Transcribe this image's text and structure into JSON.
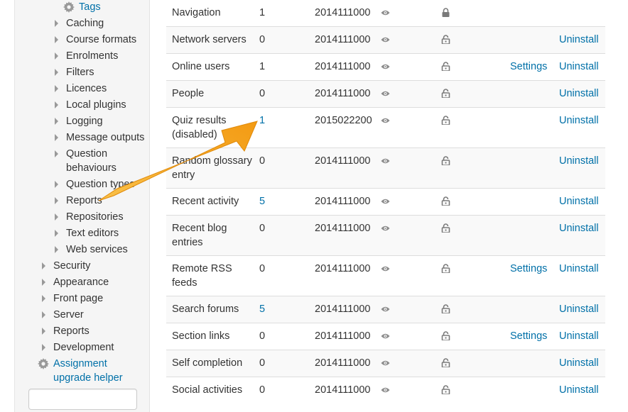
{
  "sidebar": {
    "tags_label": "Tags",
    "sub_items": [
      {
        "label": "Caching"
      },
      {
        "label": "Course formats"
      },
      {
        "label": "Enrolments"
      },
      {
        "label": "Filters"
      },
      {
        "label": "Licences"
      },
      {
        "label": "Local plugins"
      },
      {
        "label": "Logging"
      },
      {
        "label": "Message outputs"
      },
      {
        "label": "Question behaviours"
      },
      {
        "label": "Question types"
      },
      {
        "label": "Reports"
      },
      {
        "label": "Repositories"
      },
      {
        "label": "Text editors"
      },
      {
        "label": "Web services"
      }
    ],
    "top_items": [
      {
        "label": "Security"
      },
      {
        "label": "Appearance"
      },
      {
        "label": "Front page"
      },
      {
        "label": "Server"
      },
      {
        "label": "Reports"
      },
      {
        "label": "Development"
      }
    ],
    "assignment_helper_label": "Assignment upgrade helper",
    "search_value": ""
  },
  "plugins": [
    {
      "name": "Navigation",
      "count": "1",
      "version": "2014111000",
      "settings": "",
      "uninstall": ""
    },
    {
      "name": "Network servers",
      "count": "0",
      "version": "2014111000",
      "settings": "",
      "uninstall": "Uninstall"
    },
    {
      "name": "Online users",
      "count": "1",
      "version": "2014111000",
      "settings": "Settings",
      "uninstall": "Uninstall"
    },
    {
      "name": "People",
      "count": "0",
      "version": "2014111000",
      "settings": "",
      "uninstall": "Uninstall"
    },
    {
      "name": "Quiz results (disabled)",
      "count": "1",
      "version": "2015022200",
      "settings": "",
      "uninstall": "Uninstall"
    },
    {
      "name": "Random glossary entry",
      "count": "0",
      "version": "2014111000",
      "settings": "",
      "uninstall": "Uninstall"
    },
    {
      "name": "Recent activity",
      "count": "5",
      "version": "2014111000",
      "settings": "",
      "uninstall": "Uninstall"
    },
    {
      "name": "Recent blog entries",
      "count": "0",
      "version": "2014111000",
      "settings": "",
      "uninstall": "Uninstall"
    },
    {
      "name": "Remote RSS feeds",
      "count": "0",
      "version": "2014111000",
      "settings": "Settings",
      "uninstall": "Uninstall"
    },
    {
      "name": "Search forums",
      "count": "5",
      "version": "2014111000",
      "settings": "",
      "uninstall": "Uninstall"
    },
    {
      "name": "Section links",
      "count": "0",
      "version": "2014111000",
      "settings": "Settings",
      "uninstall": "Uninstall"
    },
    {
      "name": "Self completion",
      "count": "0",
      "version": "2014111000",
      "settings": "",
      "uninstall": "Uninstall"
    },
    {
      "name": "Social activities",
      "count": "0",
      "version": "2014111000",
      "settings": "",
      "uninstall": "Uninstall"
    }
  ],
  "colors": {
    "link": "#0070a8",
    "arrow": "#f7a928",
    "stripe": "#f9f9f9"
  }
}
